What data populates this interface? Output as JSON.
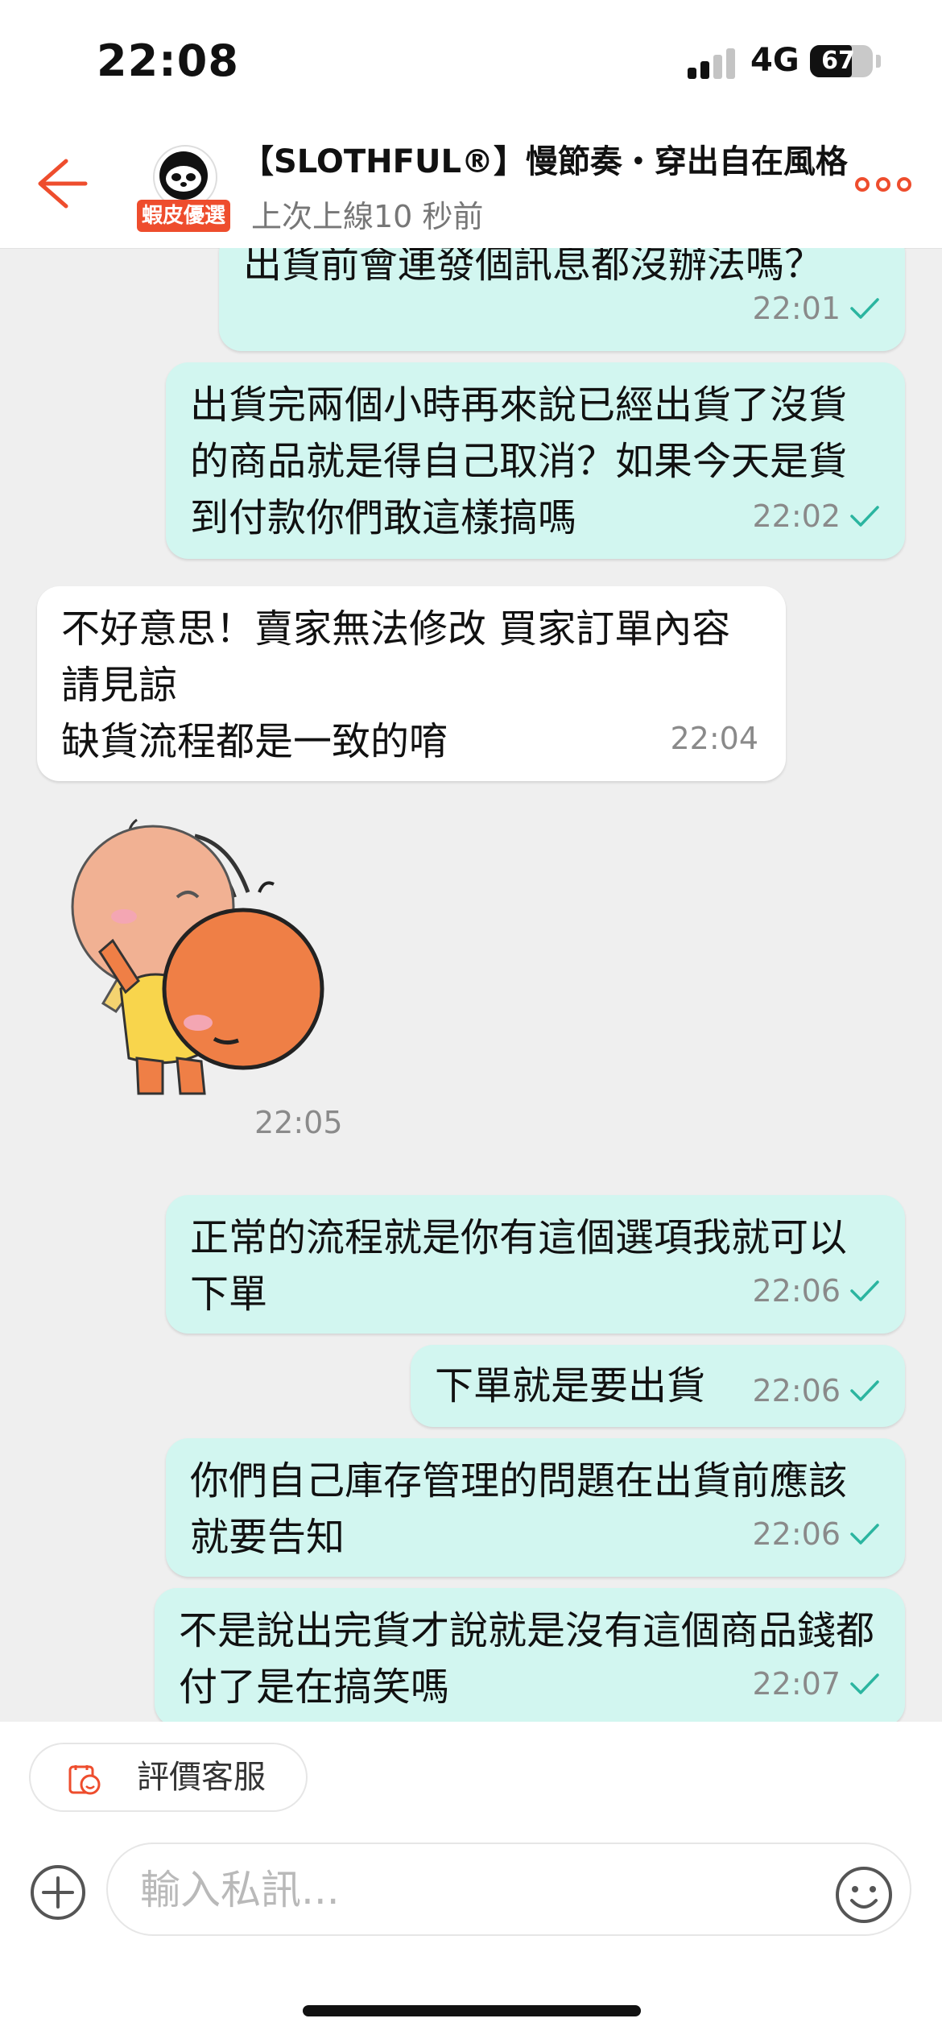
{
  "status": {
    "time": "22:08",
    "network": "4G",
    "battery": "67"
  },
  "header": {
    "shop_name": "【SLOTHFUL®】慢節奏・穿出自在風格",
    "badge": "蝦皮優選",
    "last_seen": "上次上線10 秒前"
  },
  "messages": [
    {
      "dir": "out",
      "text": "出貨前會連發個訊息都沒辦法嗎？",
      "time": "22:01"
    },
    {
      "dir": "out",
      "text": "出貨完兩個小時再來說已經出貨了沒貨的商品就是得自己取消？如果今天是貨到付款你們敢這樣搞嗎",
      "time": "22:02"
    },
    {
      "dir": "in",
      "text": "不好意思！賣家無法修改 買家訂單內容 請見諒\n缺貨流程都是一致的唷",
      "time": "22:04"
    },
    {
      "dir": "in-sticker",
      "time": "22:05"
    },
    {
      "dir": "out",
      "text": "正常的流程就是你有這個選項我就可以下單",
      "time": "22:06"
    },
    {
      "dir": "out",
      "text": "下單就是要出貨",
      "time": "22:06"
    },
    {
      "dir": "out",
      "text": "你們自己庫存管理的問題在出貨前應該就要告知",
      "time": "22:06"
    },
    {
      "dir": "out",
      "text": "不是說出完貨才說就是沒有這個商品錢都付了是在搞笑嗎",
      "time": "22:07"
    }
  ],
  "bottom": {
    "rate_label": "評價客服",
    "input_placeholder": "輸入私訊..."
  },
  "colors": {
    "accent": "#ee4d2d",
    "outgoing_bubble": "#d2f6f0",
    "check": "#2bb5a0"
  }
}
